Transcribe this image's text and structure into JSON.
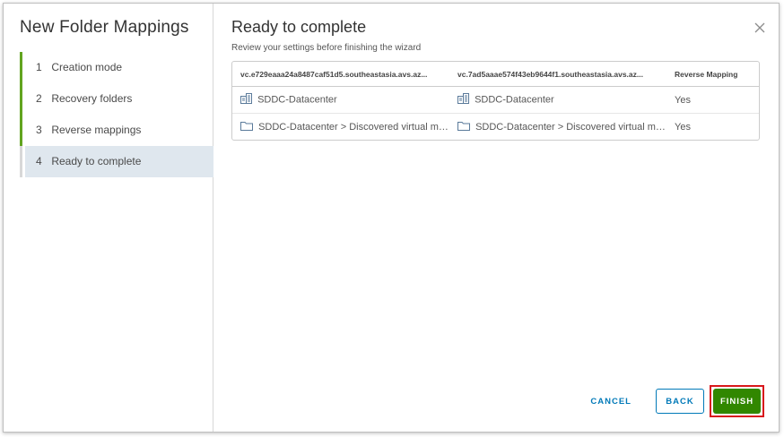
{
  "wizard": {
    "title": "New Folder Mappings",
    "steps": [
      {
        "num": "1",
        "label": "Creation mode"
      },
      {
        "num": "2",
        "label": "Recovery folders"
      },
      {
        "num": "3",
        "label": "Reverse mappings"
      },
      {
        "num": "4",
        "label": "Ready to complete"
      }
    ]
  },
  "main": {
    "title": "Ready to complete",
    "subtitle": "Review your settings before finishing the wizard",
    "close_icon": "close-icon"
  },
  "table": {
    "columns": [
      "vc.e729eaaa24a8487caf51d5.southeastasia.avs.az...",
      "vc.7ad5aaae574f43eb9644f1.southeastasia.avs.az...",
      "Reverse Mapping"
    ],
    "rows": [
      {
        "icon": "datacenter-icon",
        "source": "SDDC-Datacenter",
        "target": "SDDC-Datacenter",
        "reverse": "Yes"
      },
      {
        "icon": "folder-icon",
        "source": "SDDC-Datacenter > Discovered virtual mac...",
        "target": "SDDC-Datacenter > Discovered virtual mac...",
        "reverse": "Yes"
      }
    ]
  },
  "footer": {
    "cancel_label": "CANCEL",
    "back_label": "BACK",
    "finish_label": "FINISH"
  },
  "colors": {
    "accent": "#0079b8",
    "step_complete": "#62a420",
    "finish_bg": "#318700",
    "highlight_border": "#d8171c",
    "current_step_bg": "#dfe7ee"
  }
}
